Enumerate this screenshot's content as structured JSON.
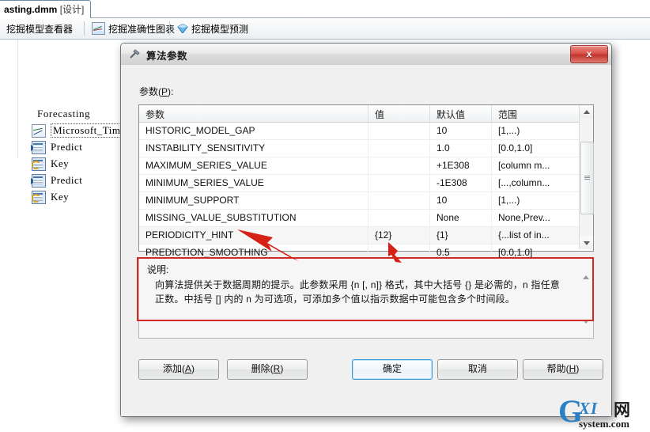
{
  "ide": {
    "tab": {
      "label": "asting.dmm ",
      "suffix": "[设计]"
    },
    "toolbar": {
      "items": [
        {
          "label": "挖掘模型查看器",
          "icon": ""
        },
        {
          "label": "挖掘准确性图表",
          "icon": "chart-icon"
        },
        {
          "label": "挖掘模型预测",
          "icon": "diamond-icon"
        }
      ]
    },
    "tree": {
      "title": "Forecasting",
      "rows": [
        {
          "label": "Microsoft_Tim",
          "icon": "line-chart-icon",
          "selected": true
        },
        {
          "label": "Predict",
          "icon": "predict-table-icon",
          "selected": false
        },
        {
          "label": "Key",
          "icon": "key-icon",
          "selected": false
        },
        {
          "label": "Predict",
          "icon": "predict-table-icon",
          "selected": false
        },
        {
          "label": "Key",
          "icon": "key-icon",
          "selected": false
        }
      ]
    }
  },
  "dialog": {
    "title": "算法参数",
    "close_label": "x",
    "parameters_label_pre": "参数(",
    "parameters_label_key": "P",
    "parameters_label_post": "):",
    "grid": {
      "headers": [
        "参数",
        "值",
        "默认值",
        "范围"
      ],
      "rows": [
        {
          "name": "HISTORIC_MODEL_GAP",
          "value": "",
          "default": "10",
          "range": "[1,...)"
        },
        {
          "name": "INSTABILITY_SENSITIVITY",
          "value": "",
          "default": "1.0",
          "range": "[0.0,1.0]"
        },
        {
          "name": "MAXIMUM_SERIES_VALUE",
          "value": "",
          "default": "+1E308",
          "range": "[column m..."
        },
        {
          "name": "MINIMUM_SERIES_VALUE",
          "value": "",
          "default": "-1E308",
          "range": "[...,column..."
        },
        {
          "name": "MINIMUM_SUPPORT",
          "value": "",
          "default": "10",
          "range": "[1,...)"
        },
        {
          "name": "MISSING_VALUE_SUBSTITUTION",
          "value": "",
          "default": "None",
          "range": "None,Prev..."
        },
        {
          "name": "PERIODICITY_HINT",
          "value": "{12}",
          "default": "{1}",
          "range": "{...list of in..."
        },
        {
          "name": "PREDICTION_SMOOTHING",
          "value": "",
          "default": "0.5",
          "range": "[0.0,1.0]"
        }
      ]
    },
    "description": {
      "title": "说明:",
      "text": "向算法提供关于数据周期的提示。此参数采用 {n [, n]} 格式，其中大括号 {} 是必需的，n 指任意正数。中括号 [] 内的 n 为可选项，可添加多个值以指示数据中可能包含多个时间段。"
    },
    "buttons": {
      "add": {
        "pre": "添加(",
        "key": "A",
        "post": ")"
      },
      "remove": {
        "pre": "删除(",
        "key": "R",
        "post": ")"
      },
      "ok": "确定",
      "cancel": "取消",
      "help": {
        "pre": "帮助(",
        "key": "H",
        "post": ")"
      }
    }
  },
  "annotation": {
    "color": "#cf2b26",
    "arrow_count": 2
  },
  "watermark": {
    "g": "G",
    "xi": "XI",
    "cn": "网",
    "domain": "system.com"
  }
}
